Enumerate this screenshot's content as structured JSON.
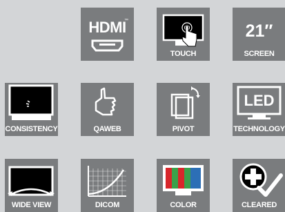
{
  "background_color": "#d3d5d7",
  "tile_color": "#7a7c7e",
  "tiles": [
    {
      "icon": "hdmi-icon",
      "text": "HDMI",
      "tm": "™",
      "label": ""
    },
    {
      "icon": "touch-icon",
      "label": "TOUCH"
    },
    {
      "icon": "screen-size-icon",
      "text": "21″",
      "label": "SCREEN"
    },
    {
      "icon": "consistency-icon",
      "label": "CONSISTENCY"
    },
    {
      "icon": "qaweb-icon",
      "label": "QAWEB"
    },
    {
      "icon": "pivot-icon",
      "label": "PIVOT"
    },
    {
      "icon": "led-technology-icon",
      "text": "LED",
      "label": "TECHNOLOGY"
    },
    {
      "icon": "wide-view-icon",
      "label": "WIDE VIEW"
    },
    {
      "icon": "dicom-icon",
      "label": "DICOM"
    },
    {
      "icon": "color-icon",
      "label": "COLOR"
    },
    {
      "icon": "cleared-icon",
      "label": "CLEARED"
    }
  ]
}
